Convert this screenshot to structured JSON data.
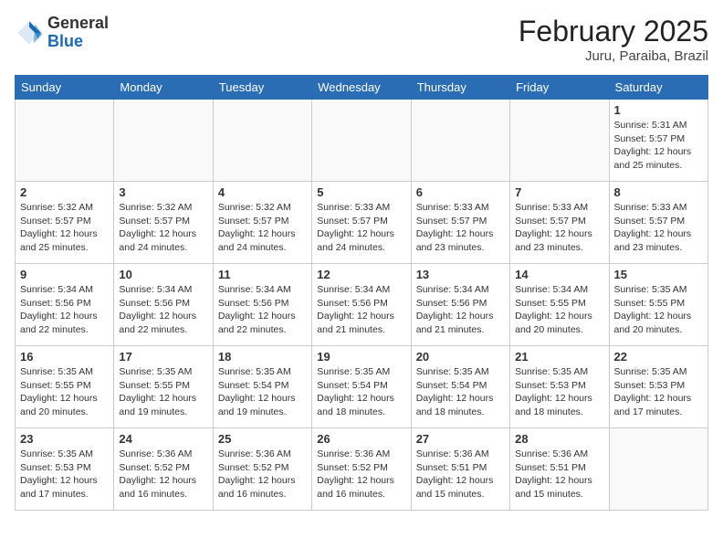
{
  "header": {
    "logo_general": "General",
    "logo_blue": "Blue",
    "month": "February 2025",
    "location": "Juru, Paraiba, Brazil"
  },
  "weekdays": [
    "Sunday",
    "Monday",
    "Tuesday",
    "Wednesday",
    "Thursday",
    "Friday",
    "Saturday"
  ],
  "weeks": [
    [
      {
        "day": "",
        "info": ""
      },
      {
        "day": "",
        "info": ""
      },
      {
        "day": "",
        "info": ""
      },
      {
        "day": "",
        "info": ""
      },
      {
        "day": "",
        "info": ""
      },
      {
        "day": "",
        "info": ""
      },
      {
        "day": "1",
        "info": "Sunrise: 5:31 AM\nSunset: 5:57 PM\nDaylight: 12 hours\nand 25 minutes."
      }
    ],
    [
      {
        "day": "2",
        "info": "Sunrise: 5:32 AM\nSunset: 5:57 PM\nDaylight: 12 hours\nand 25 minutes."
      },
      {
        "day": "3",
        "info": "Sunrise: 5:32 AM\nSunset: 5:57 PM\nDaylight: 12 hours\nand 24 minutes."
      },
      {
        "day": "4",
        "info": "Sunrise: 5:32 AM\nSunset: 5:57 PM\nDaylight: 12 hours\nand 24 minutes."
      },
      {
        "day": "5",
        "info": "Sunrise: 5:33 AM\nSunset: 5:57 PM\nDaylight: 12 hours\nand 24 minutes."
      },
      {
        "day": "6",
        "info": "Sunrise: 5:33 AM\nSunset: 5:57 PM\nDaylight: 12 hours\nand 23 minutes."
      },
      {
        "day": "7",
        "info": "Sunrise: 5:33 AM\nSunset: 5:57 PM\nDaylight: 12 hours\nand 23 minutes."
      },
      {
        "day": "8",
        "info": "Sunrise: 5:33 AM\nSunset: 5:57 PM\nDaylight: 12 hours\nand 23 minutes."
      }
    ],
    [
      {
        "day": "9",
        "info": "Sunrise: 5:34 AM\nSunset: 5:56 PM\nDaylight: 12 hours\nand 22 minutes."
      },
      {
        "day": "10",
        "info": "Sunrise: 5:34 AM\nSunset: 5:56 PM\nDaylight: 12 hours\nand 22 minutes."
      },
      {
        "day": "11",
        "info": "Sunrise: 5:34 AM\nSunset: 5:56 PM\nDaylight: 12 hours\nand 22 minutes."
      },
      {
        "day": "12",
        "info": "Sunrise: 5:34 AM\nSunset: 5:56 PM\nDaylight: 12 hours\nand 21 minutes."
      },
      {
        "day": "13",
        "info": "Sunrise: 5:34 AM\nSunset: 5:56 PM\nDaylight: 12 hours\nand 21 minutes."
      },
      {
        "day": "14",
        "info": "Sunrise: 5:34 AM\nSunset: 5:55 PM\nDaylight: 12 hours\nand 20 minutes."
      },
      {
        "day": "15",
        "info": "Sunrise: 5:35 AM\nSunset: 5:55 PM\nDaylight: 12 hours\nand 20 minutes."
      }
    ],
    [
      {
        "day": "16",
        "info": "Sunrise: 5:35 AM\nSunset: 5:55 PM\nDaylight: 12 hours\nand 20 minutes."
      },
      {
        "day": "17",
        "info": "Sunrise: 5:35 AM\nSunset: 5:55 PM\nDaylight: 12 hours\nand 19 minutes."
      },
      {
        "day": "18",
        "info": "Sunrise: 5:35 AM\nSunset: 5:54 PM\nDaylight: 12 hours\nand 19 minutes."
      },
      {
        "day": "19",
        "info": "Sunrise: 5:35 AM\nSunset: 5:54 PM\nDaylight: 12 hours\nand 18 minutes."
      },
      {
        "day": "20",
        "info": "Sunrise: 5:35 AM\nSunset: 5:54 PM\nDaylight: 12 hours\nand 18 minutes."
      },
      {
        "day": "21",
        "info": "Sunrise: 5:35 AM\nSunset: 5:53 PM\nDaylight: 12 hours\nand 18 minutes."
      },
      {
        "day": "22",
        "info": "Sunrise: 5:35 AM\nSunset: 5:53 PM\nDaylight: 12 hours\nand 17 minutes."
      }
    ],
    [
      {
        "day": "23",
        "info": "Sunrise: 5:35 AM\nSunset: 5:53 PM\nDaylight: 12 hours\nand 17 minutes."
      },
      {
        "day": "24",
        "info": "Sunrise: 5:36 AM\nSunset: 5:52 PM\nDaylight: 12 hours\nand 16 minutes."
      },
      {
        "day": "25",
        "info": "Sunrise: 5:36 AM\nSunset: 5:52 PM\nDaylight: 12 hours\nand 16 minutes."
      },
      {
        "day": "26",
        "info": "Sunrise: 5:36 AM\nSunset: 5:52 PM\nDaylight: 12 hours\nand 16 minutes."
      },
      {
        "day": "27",
        "info": "Sunrise: 5:36 AM\nSunset: 5:51 PM\nDaylight: 12 hours\nand 15 minutes."
      },
      {
        "day": "28",
        "info": "Sunrise: 5:36 AM\nSunset: 5:51 PM\nDaylight: 12 hours\nand 15 minutes."
      },
      {
        "day": "",
        "info": ""
      }
    ]
  ]
}
